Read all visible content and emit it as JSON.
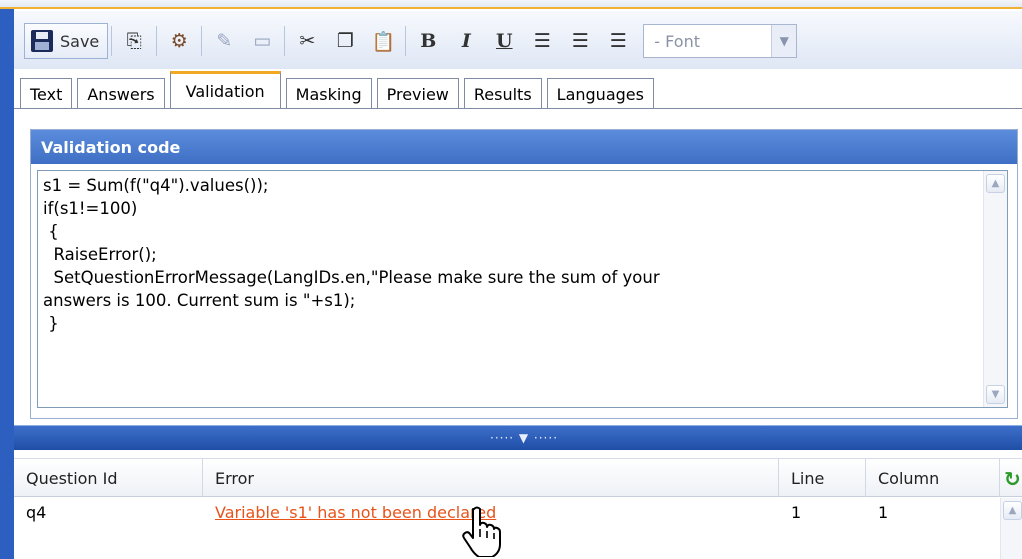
{
  "toolbar": {
    "save_label": "Save",
    "font_select_value": "- Font",
    "icons": [
      "save-icon",
      "copy-icon",
      "paste-special-icon",
      "edit-icon",
      "preview-icon",
      "cut-icon",
      "copy-doc-icon",
      "paste-icon",
      "bold-icon",
      "italic-icon",
      "underline-icon",
      "align-left-icon",
      "align-center-icon",
      "align-right-icon"
    ],
    "bold_glyph": "B",
    "italic_glyph": "I",
    "underline_glyph": "U"
  },
  "tabs": [
    {
      "label": "Text",
      "active": false
    },
    {
      "label": "Answers",
      "active": false
    },
    {
      "label": "Validation",
      "active": true
    },
    {
      "label": "Masking",
      "active": false
    },
    {
      "label": "Preview",
      "active": false
    },
    {
      "label": "Results",
      "active": false
    },
    {
      "label": "Languages",
      "active": false
    }
  ],
  "validation": {
    "title": "Validation code",
    "code": "s1 = Sum(f(\"q4\").values());\nif(s1!=100)\n {\n  RaiseError();\n  SetQuestionErrorMessage(LangIDs.en,\"Please make sure the sum of your\nanswers is 100. Current sum is \"+s1);\n }"
  },
  "errors": {
    "columns": {
      "question_id": "Question Id",
      "error": "Error",
      "line": "Line",
      "column": "Column"
    },
    "rows": [
      {
        "question_id": "q4",
        "error": "Variable 's1' has not been declared",
        "line": "1",
        "column": "1"
      }
    ]
  },
  "colors": {
    "accent_blue": "#3e6fc4",
    "tab_highlight": "#f0a825",
    "error_link": "#e8531a"
  }
}
